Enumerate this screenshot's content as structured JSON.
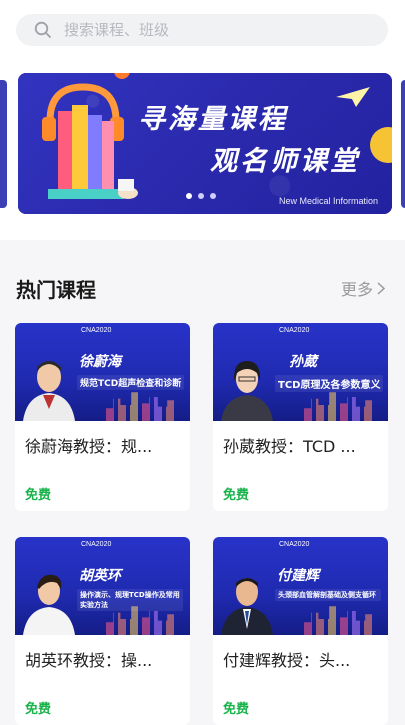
{
  "search": {
    "placeholder": "搜索课程、班级"
  },
  "banner": {
    "title_line1": "寻海量课程",
    "title_line2": "观名师课堂",
    "subtitle": "New Medical Information",
    "dots": 3,
    "active_dot": 0
  },
  "section": {
    "title": "热门课程",
    "more_label": "更多"
  },
  "courses": [
    {
      "thumb_name": "徐蔚海",
      "thumb_topic": "规范TCD超声检查和诊断",
      "title": "徐蔚海教授：规...",
      "price": "免费"
    },
    {
      "thumb_name": "孙葳",
      "thumb_topic": "TCD原理及各参数意义",
      "title": "孙葳教授：TCD ...",
      "price": "免费"
    },
    {
      "thumb_name": "胡英环",
      "thumb_topic": "操作演示、规理TCD操作及常用实验方法",
      "title": "胡英环教授：操...",
      "price": "免费"
    },
    {
      "thumb_name": "付建辉",
      "thumb_topic": "头颈部血管解剖基础及侧支循环",
      "title": "付建辉教授：头...",
      "price": "免费"
    }
  ],
  "thumb_common": {
    "cna_label": "CNA2020"
  },
  "colors": {
    "accent_green": "#19b34b",
    "banner_blue": "#2a2fb8",
    "thumb_blue": "#2833c9"
  }
}
